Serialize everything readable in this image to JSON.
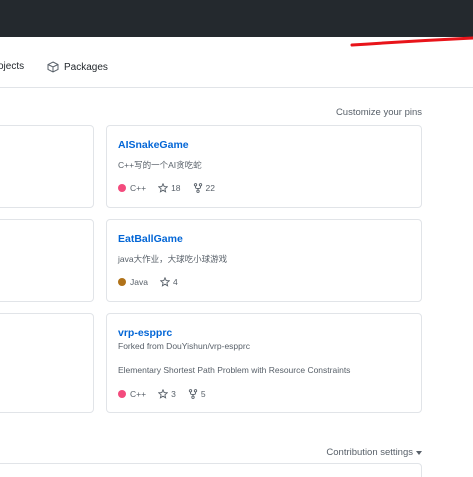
{
  "nav": {
    "projects_label": "ojects",
    "packages_label": "Packages"
  },
  "pins": {
    "customize_label": "Customize your pins",
    "repos": [
      {
        "title": "AISnakeGame",
        "description": "C++写的一个AI贪吃蛇",
        "language": "C++",
        "language_color": "#f34b7d",
        "stars": "18",
        "forks": "22"
      },
      {
        "title": "EatBallGame",
        "description": "java大作业，大球吃小球游戏",
        "language": "Java",
        "language_color": "#b07219",
        "stars": "4"
      },
      {
        "title": "vrp-espprc",
        "forked_from": "Forked from DouYishun/vrp-espprc",
        "description": "Elementary Shortest Path Problem with Resource Constraints",
        "language": "C++",
        "language_color": "#f34b7d",
        "stars": "3",
        "forks": "5"
      }
    ]
  },
  "contribution": {
    "settings_label": "Contribution settings"
  },
  "colors": {
    "header_bg": "#24292e",
    "link": "#0366d6",
    "annotation_red": "#e8141a"
  }
}
